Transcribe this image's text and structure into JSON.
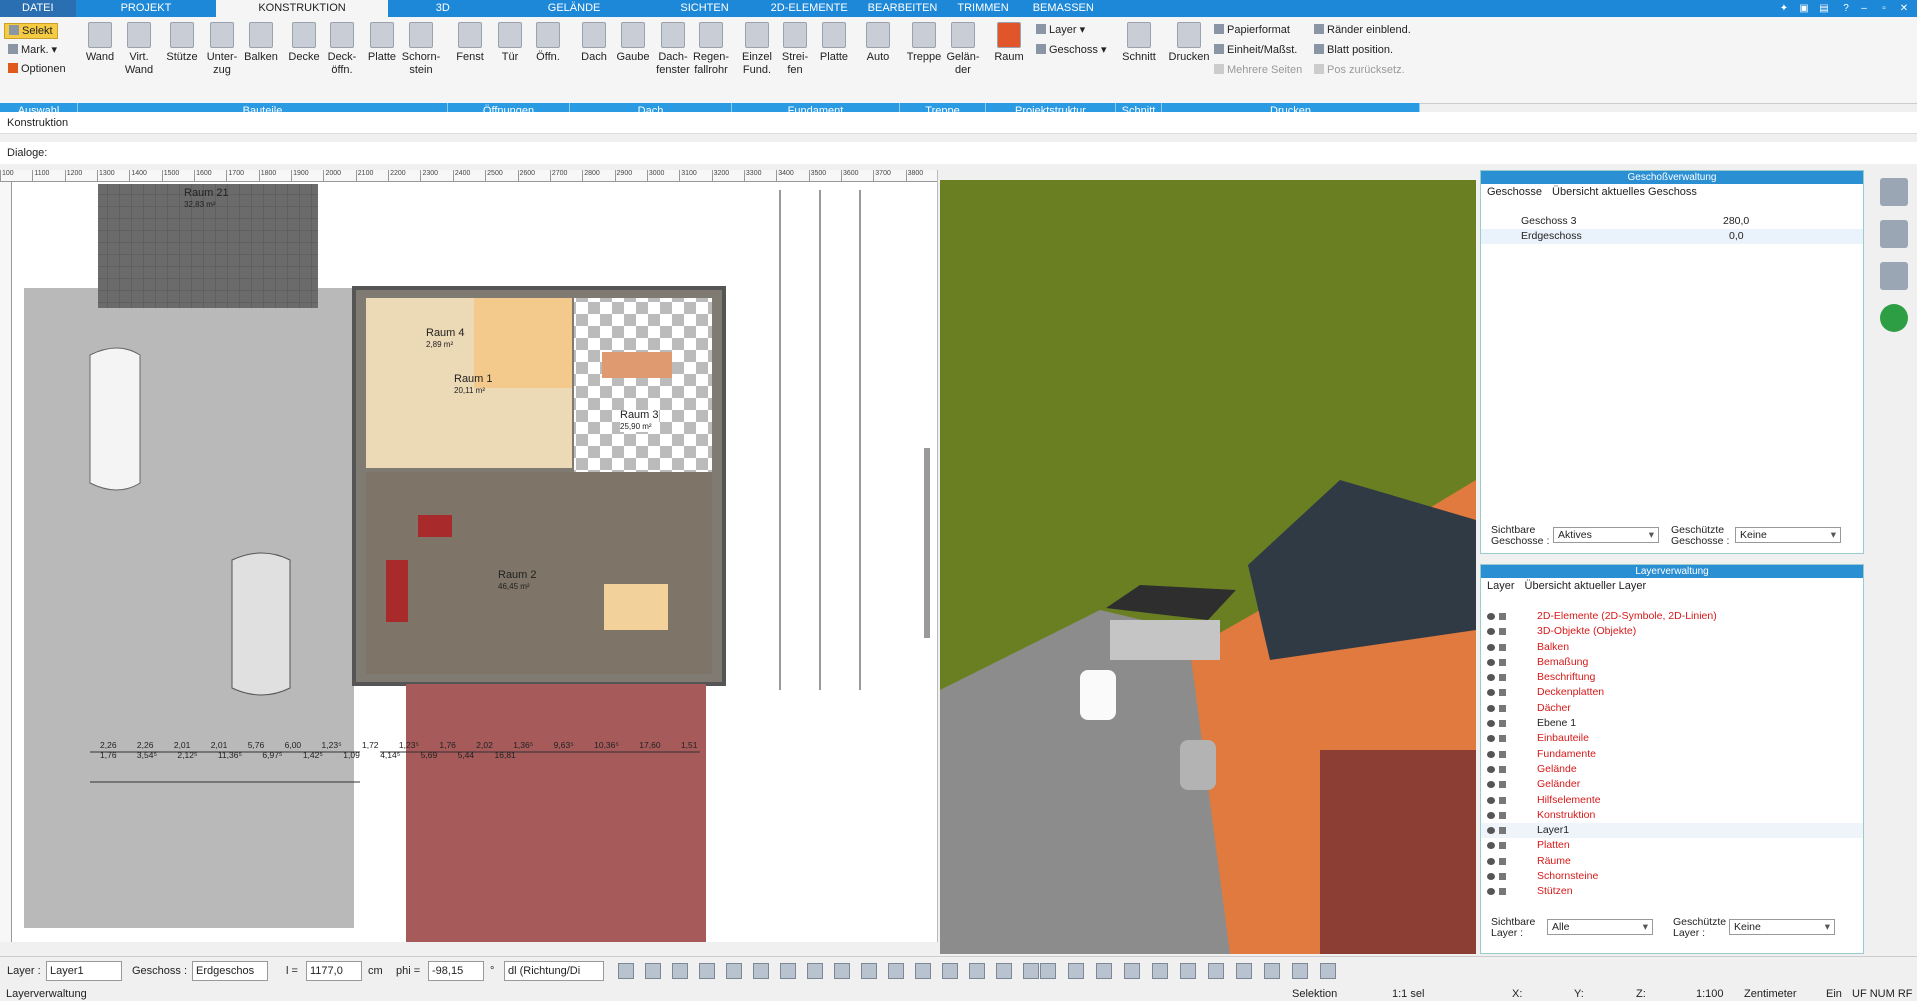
{
  "tabs": [
    "DATEI",
    "PROJEKT",
    "KONSTRUKTION",
    "3D",
    "GELÄNDE",
    "SICHTEN",
    "2D-ELEMENTE",
    "BEARBEITEN",
    "TRIMMEN",
    "BEMASSEN"
  ],
  "ribbon": {
    "auswahl": [
      "Selekt",
      "Mark.",
      "Optionen"
    ],
    "buttons": [
      "Wand",
      "Virt. Wand",
      "Stütze",
      "Unter-zug",
      "Balken",
      "Decke",
      "Deck-öffn.",
      "Platte",
      "Schorn-stein",
      "Fenst",
      "Tür",
      "Öffn.",
      "Dach",
      "Gaube",
      "Dach-fenster",
      "Regen-fallrohr",
      "Einzel Fund.",
      "Strei-fen",
      "Platte",
      "Auto",
      "Treppe",
      "Gelän-der",
      "Raum",
      "Schnitt",
      "Drucken"
    ],
    "projekt": [
      "Layer",
      "Geschoss"
    ],
    "drucken": [
      "Papierformat",
      "Einheit/Maßst.",
      "Mehrere Seiten",
      "Ränder einblend.",
      "Blatt position.",
      "Pos zurücksetz."
    ],
    "groups": [
      "Auswahl",
      "Bauteile",
      "Öffnungen",
      "Dach",
      "Fundament",
      "Treppe",
      "Projektstruktur",
      "Schnitt",
      "Drucken"
    ]
  },
  "path": "Konstruktion",
  "dialoge": "Dialoge:",
  "ruler": [
    "100",
    "1100",
    "1200",
    "1300",
    "1400",
    "1500",
    "1600",
    "1700",
    "1800",
    "1900",
    "2000",
    "2100",
    "2200",
    "2300",
    "2400",
    "2500",
    "2600",
    "2700",
    "2800",
    "2900",
    "3000",
    "3100",
    "3200",
    "3300",
    "3400",
    "3500",
    "3600",
    "3700",
    "3800"
  ],
  "plan": {
    "rooms": [
      {
        "name": "Raum 21",
        "area": "32,83 m²"
      },
      {
        "name": "Raum 4",
        "area": "2,89 m²"
      },
      {
        "name": "Raum 1",
        "area": "20,11 m²"
      },
      {
        "name": "Raum 3",
        "area": "25,90 m²"
      },
      {
        "name": "Raum 2",
        "area": "46,45 m²"
      }
    ],
    "dims": [
      "2,26",
      "2,26",
      "2,01",
      "2,01",
      "5,76",
      "6,00",
      "1,23⁵",
      "1,72",
      "1,23⁵",
      "1,76",
      "2,02",
      "1,36⁵",
      "9,63⁵",
      "10,36⁵",
      "17,60",
      "1,51",
      "1,76",
      "3,54⁵",
      "2,12⁵",
      "11,36⁵",
      "6,97⁵",
      "1,42⁵",
      "1,09",
      "4,14⁵",
      "5,69",
      "5,44",
      "16,81"
    ]
  },
  "geschoss": {
    "title": "Geschoßverwaltung",
    "tabs": [
      "Geschosse",
      "Übersicht aktuelles Geschoss"
    ],
    "rows": [
      {
        "name": "Geschoss 3",
        "value": "280,0"
      },
      {
        "name": "Erdgeschoss",
        "value": "0,0"
      }
    ],
    "sichtbar_label": "Sichtbare Geschosse :",
    "sichtbar_value": "Aktives",
    "geschuetzt_label": "Geschützte Geschosse :",
    "geschuetzt_value": "Keine"
  },
  "layer": {
    "title": "Layerverwaltung",
    "tabs": [
      "Layer",
      "Übersicht aktueller Layer"
    ],
    "items": [
      "2D-Elemente (2D-Symbole, 2D-Linien)",
      "3D-Objekte (Objekte)",
      "Balken",
      "Bemaßung",
      "Beschriftung",
      "Deckenplatten",
      "Dächer",
      "Ebene 1",
      "Einbauteile",
      "Fundamente",
      "Gelände",
      "Geländer",
      "Hilfselemente",
      "Konstruktion",
      "Layer1",
      "Platten",
      "Räume",
      "Schornsteine",
      "Stützen"
    ],
    "sichtbar_label": "Sichtbare Layer :",
    "sichtbar_value": "Alle",
    "geschuetzt_label": "Geschützte Layer :",
    "geschuetzt_value": "Keine"
  },
  "toolbar": {
    "layer_label": "Layer :",
    "layer_value": "Layer1",
    "geschoss_label": "Geschoss :",
    "geschoss_value": "Erdgeschos",
    "l_label": "l =",
    "l_value": "1177,0",
    "unit": "cm",
    "phi_label": "phi =",
    "phi_value": "-98,15",
    "deg": "°",
    "mode_value": "dl (Richtung/Di"
  },
  "status": {
    "left": "Layerverwaltung",
    "mode": "Selektion",
    "scale_sel": "1:1 sel",
    "x": "X:",
    "y": "Y:",
    "z": "Z:",
    "scale": "1:100",
    "unit": "Zentimeter",
    "ein": "Ein",
    "flags": "UF NUM RF"
  }
}
